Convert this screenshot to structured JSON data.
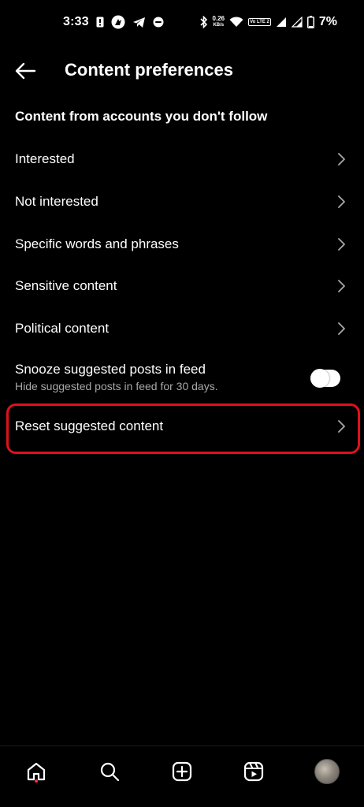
{
  "status_bar": {
    "time": "3:33",
    "speed_value": "0.26",
    "speed_unit": "KB/s",
    "volte": "Vo LTE 2",
    "battery_pct": "7%",
    "icons": [
      "alert-icon",
      "app-icon",
      "telegram-icon",
      "app-badge-icon",
      "bluetooth-icon",
      "wifi-icon",
      "signal-icon",
      "signal-icon",
      "battery-icon"
    ]
  },
  "header": {
    "back_icon": "arrow-left-icon",
    "title": "Content preferences"
  },
  "section": {
    "title": "Content from accounts you don't follow"
  },
  "items": [
    {
      "label": "Interested"
    },
    {
      "label": "Not interested"
    },
    {
      "label": "Specific words and phrases"
    },
    {
      "label": "Sensitive content"
    },
    {
      "label": "Political content"
    }
  ],
  "snooze": {
    "title": "Snooze suggested posts in feed",
    "subtitle": "Hide suggested posts in feed for 30 days.",
    "enabled": false
  },
  "reset": {
    "label": "Reset suggested content",
    "highlight_color": "#e0111a"
  },
  "bottom_nav": {
    "items": [
      "home-icon",
      "search-icon",
      "create-icon",
      "reels-icon",
      "profile-avatar"
    ],
    "active": "home-icon",
    "notification_dot_color": "#ff3040"
  }
}
